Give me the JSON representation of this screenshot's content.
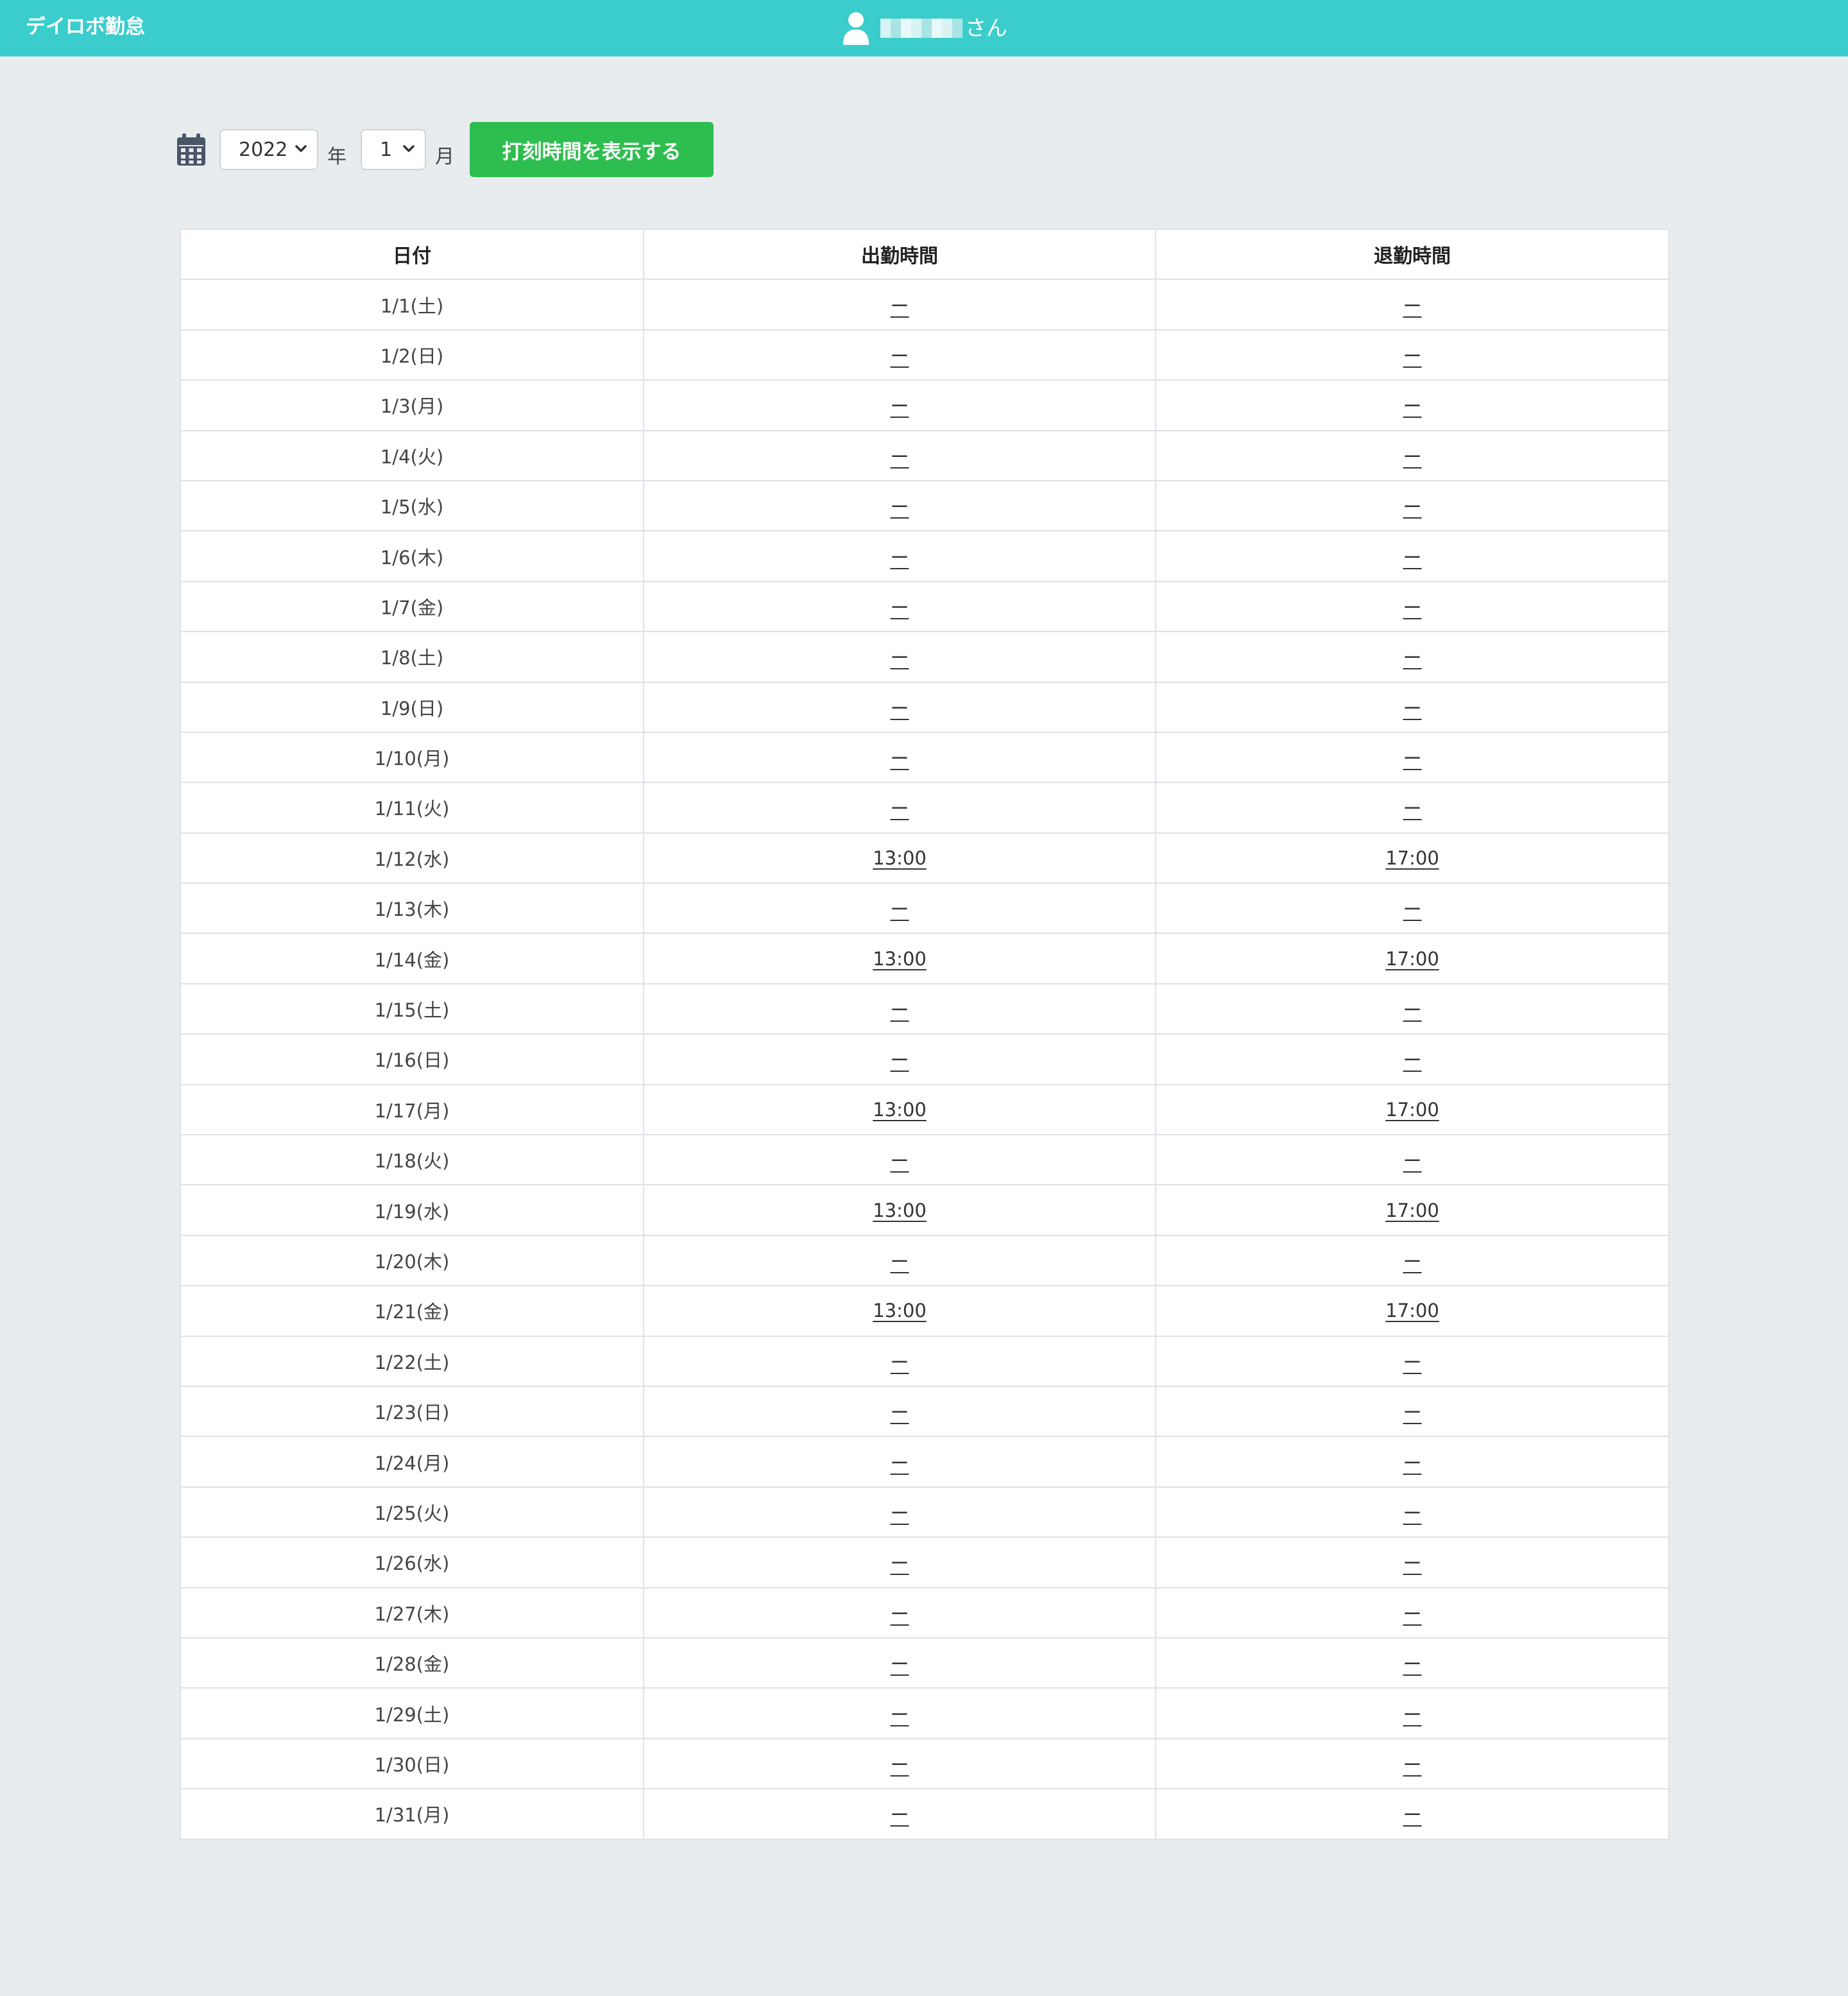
{
  "navbar": {
    "brand": "デイロボ勤怠",
    "user_suffix": "さん"
  },
  "controls": {
    "year": "2022",
    "year_unit": "年",
    "month": "1",
    "month_unit": "月",
    "show_button": "打刻時間を表示する"
  },
  "table": {
    "headers": [
      "日付",
      "出勤時間",
      "退勤時間"
    ],
    "rows": [
      {
        "date": "1/1(土)",
        "in": "ー",
        "out": "ー"
      },
      {
        "date": "1/2(日)",
        "in": "ー",
        "out": "ー"
      },
      {
        "date": "1/3(月)",
        "in": "ー",
        "out": "ー"
      },
      {
        "date": "1/4(火)",
        "in": "ー",
        "out": "ー"
      },
      {
        "date": "1/5(水)",
        "in": "ー",
        "out": "ー"
      },
      {
        "date": "1/6(木)",
        "in": "ー",
        "out": "ー"
      },
      {
        "date": "1/7(金)",
        "in": "ー",
        "out": "ー"
      },
      {
        "date": "1/8(土)",
        "in": "ー",
        "out": "ー"
      },
      {
        "date": "1/9(日)",
        "in": "ー",
        "out": "ー"
      },
      {
        "date": "1/10(月)",
        "in": "ー",
        "out": "ー"
      },
      {
        "date": "1/11(火)",
        "in": "ー",
        "out": "ー"
      },
      {
        "date": "1/12(水)",
        "in": "13:00",
        "out": "17:00"
      },
      {
        "date": "1/13(木)",
        "in": "ー",
        "out": "ー"
      },
      {
        "date": "1/14(金)",
        "in": "13:00",
        "out": "17:00"
      },
      {
        "date": "1/15(土)",
        "in": "ー",
        "out": "ー"
      },
      {
        "date": "1/16(日)",
        "in": "ー",
        "out": "ー"
      },
      {
        "date": "1/17(月)",
        "in": "13:00",
        "out": "17:00"
      },
      {
        "date": "1/18(火)",
        "in": "ー",
        "out": "ー"
      },
      {
        "date": "1/19(水)",
        "in": "13:00",
        "out": "17:00"
      },
      {
        "date": "1/20(木)",
        "in": "ー",
        "out": "ー"
      },
      {
        "date": "1/21(金)",
        "in": "13:00",
        "out": "17:00"
      },
      {
        "date": "1/22(土)",
        "in": "ー",
        "out": "ー"
      },
      {
        "date": "1/23(日)",
        "in": "ー",
        "out": "ー"
      },
      {
        "date": "1/24(月)",
        "in": "ー",
        "out": "ー"
      },
      {
        "date": "1/25(火)",
        "in": "ー",
        "out": "ー"
      },
      {
        "date": "1/26(水)",
        "in": "ー",
        "out": "ー"
      },
      {
        "date": "1/27(木)",
        "in": "ー",
        "out": "ー"
      },
      {
        "date": "1/28(金)",
        "in": "ー",
        "out": "ー"
      },
      {
        "date": "1/29(土)",
        "in": "ー",
        "out": "ー"
      },
      {
        "date": "1/30(日)",
        "in": "ー",
        "out": "ー"
      },
      {
        "date": "1/31(月)",
        "in": "ー",
        "out": "ー"
      }
    ]
  }
}
